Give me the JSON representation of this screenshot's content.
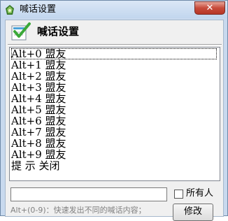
{
  "window": {
    "title": "喊话设置",
    "close_label": "✕"
  },
  "header": {
    "title": "喊话设置"
  },
  "list": {
    "items": [
      "Alt+0 盟友",
      "Alt+1 盟友",
      "Alt+2 盟友",
      "Alt+3 盟友",
      "Alt+4 盟友",
      "Alt+5 盟友",
      "Alt+6 盟友",
      "Alt+7 盟友",
      "Alt+8 盟友",
      "Alt+9 盟友",
      "提 示 关闭"
    ],
    "selected_index": 0
  },
  "message": {
    "value": ""
  },
  "all_players": {
    "label": "所有人",
    "checked": false
  },
  "hint": "Alt+(0-9)：快速发出不同的喊话内容；",
  "modify_button": {
    "label": "修改"
  }
}
